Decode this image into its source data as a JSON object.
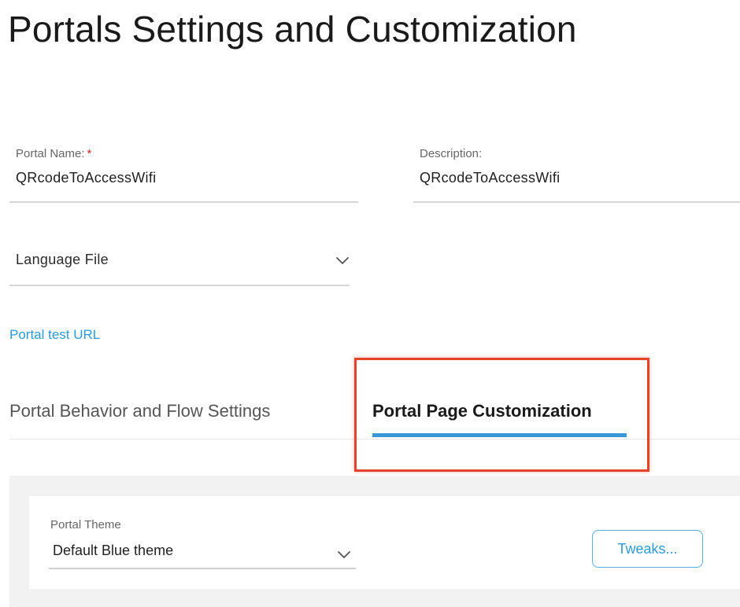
{
  "page": {
    "title": "Portals Settings and Customization"
  },
  "form": {
    "portal_name": {
      "label": "Portal Name:",
      "required_marker": "*",
      "value": "QRcodeToAccessWifi"
    },
    "description": {
      "label": "Description:",
      "value": "QRcodeToAccessWifi"
    },
    "language_file": {
      "placeholder": "Language File"
    },
    "portal_test_url_label": "Portal test URL"
  },
  "tabs": [
    {
      "label": "Portal Behavior and Flow Settings",
      "active": false
    },
    {
      "label": "Portal Page Customization",
      "active": true
    }
  ],
  "customization": {
    "theme_label": "Portal Theme",
    "theme_value": "Default Blue theme",
    "tweaks_button": "Tweaks..."
  },
  "colors": {
    "accent": "#3a98d6",
    "link": "#2b9bd8",
    "highlight": "#e3442b",
    "required": "#d0271d"
  },
  "icons": {
    "dropdown": "chevron-down-icon"
  }
}
